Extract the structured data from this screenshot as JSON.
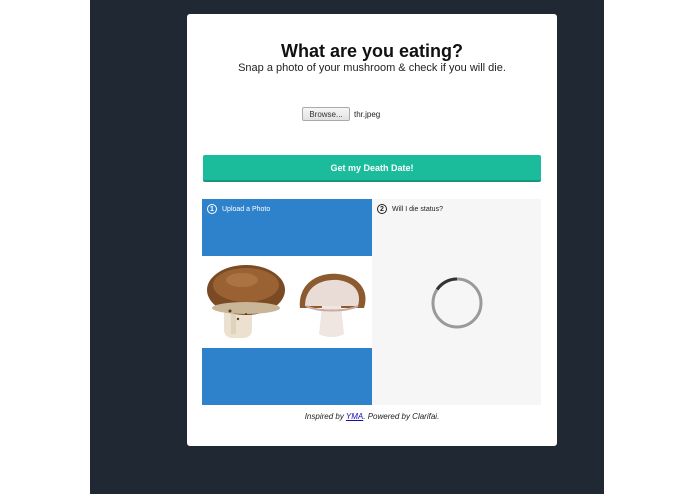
{
  "header": {
    "title": "What are you eating?",
    "subtitle": "Snap a photo of your mushroom & check if you will die."
  },
  "upload": {
    "browse_label": "Browse...",
    "file_name": "thr.jpeg"
  },
  "cta": {
    "label": "Get my Death Date!"
  },
  "steps": [
    {
      "number": "1",
      "label": "Upload a Photo"
    },
    {
      "number": "2",
      "label": "Will I die status?"
    }
  ],
  "footer": {
    "prefix": "Inspired by ",
    "link": "YMA",
    "suffix": ". Powered by Clarifai."
  },
  "colors": {
    "backdrop": "#1f2833",
    "accent": "#1bbc9b",
    "upload_panel": "#2e82cc",
    "status_panel": "#f6f6f7"
  }
}
